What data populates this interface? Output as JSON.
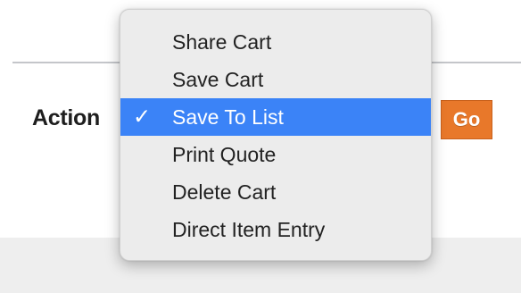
{
  "form": {
    "action_label": "Action",
    "go_label": "Go",
    "go_color": "#e8782a"
  },
  "dropdown": {
    "selected_index": 2,
    "selected_value": "Save To List",
    "check_glyph": "✓",
    "highlight_color": "#3b83f7",
    "items": [
      {
        "label": "Share Cart"
      },
      {
        "label": "Save Cart"
      },
      {
        "label": "Save To List"
      },
      {
        "label": "Print Quote"
      },
      {
        "label": "Delete Cart"
      },
      {
        "label": "Direct Item Entry"
      }
    ]
  }
}
